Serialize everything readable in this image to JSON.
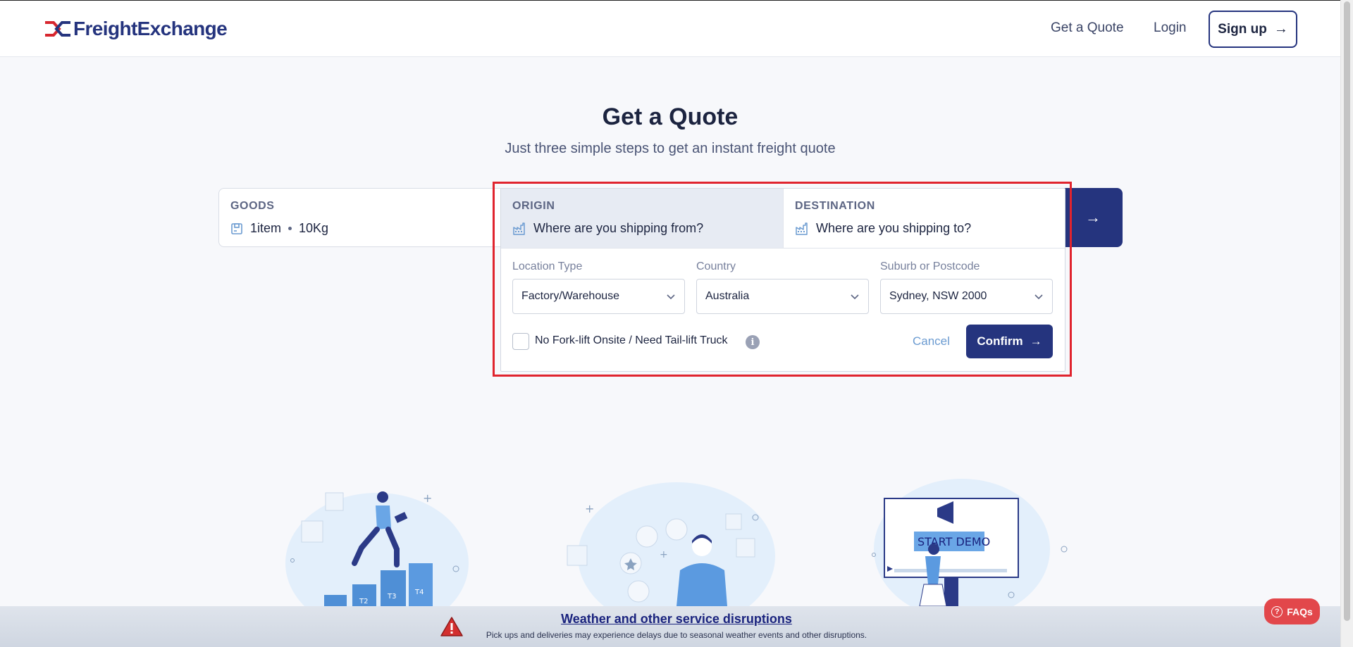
{
  "brand": {
    "name": "FreightExchange"
  },
  "nav": {
    "quote": "Get a Quote",
    "login": "Login",
    "signup": "Sign up"
  },
  "hero": {
    "title": "Get a Quote",
    "subtitle": "Just three simple steps to get an instant freight quote"
  },
  "quote_bar": {
    "goods_label": "GOODS",
    "items": "1item",
    "weight": "10Kg",
    "origin_label": "ORIGIN",
    "origin_value": "Where are you shipping from?",
    "destination_label": "DESTINATION",
    "destination_value": "Where are you shipping to?"
  },
  "origin_form": {
    "location_type_label": "Location Type",
    "location_type_value": "Factory/Warehouse",
    "country_label": "Country",
    "country_value": "Australia",
    "suburb_label": "Suburb or Postcode",
    "suburb_value": "Sydney, NSW 2000",
    "forklift_label": "No Fork-lift Onsite / Need Tail-lift Truck",
    "forklift_checked": false,
    "cancel": "Cancel",
    "confirm": "Confirm"
  },
  "illustrations": {
    "demo_label": "START DEMO",
    "steps": [
      "T2",
      "T3",
      "T4"
    ]
  },
  "banner": {
    "title": "Weather and other service disruptions",
    "text": "Pick ups and deliveries may experience delays due to seasonal weather events and other disruptions."
  },
  "faqs": "FAQs",
  "colors": {
    "brand": "#25347e",
    "accent": "#e0242e",
    "link": "#6b9bd1"
  }
}
